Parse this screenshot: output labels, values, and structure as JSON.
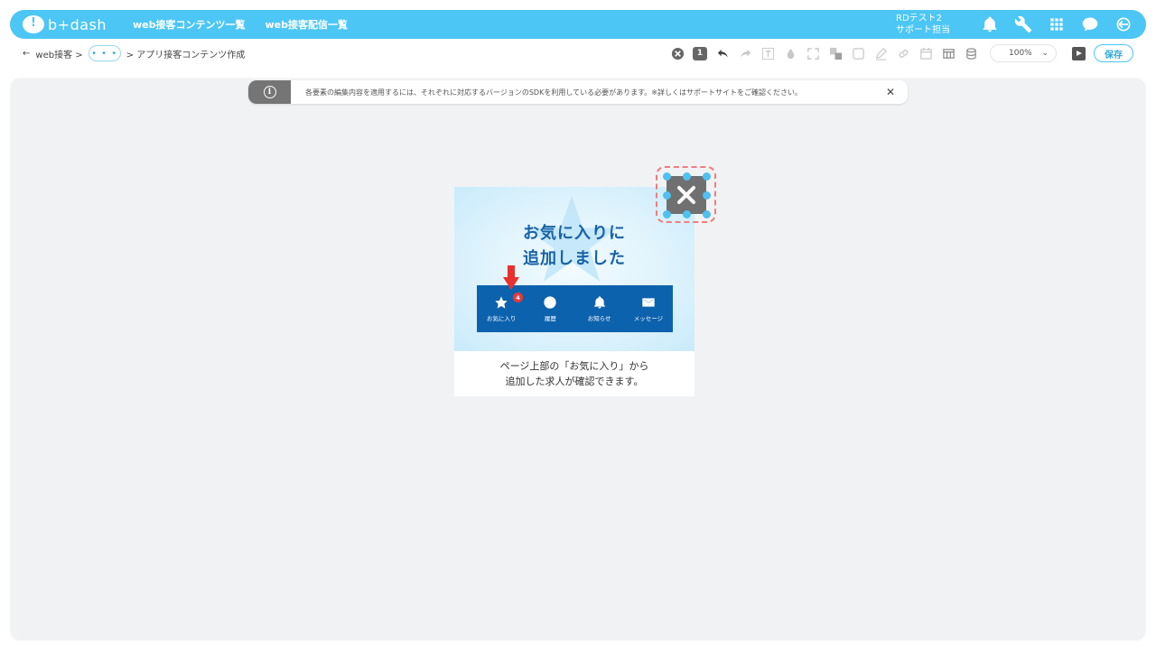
{
  "header": {
    "logo_text": "b+dash",
    "nav": [
      "web接客コンテンツ一覧",
      "web接客配信一覧"
    ],
    "user_line1": "RDテスト2",
    "user_line2": "サポート担当"
  },
  "breadcrumb": {
    "back_label": "web接客 >",
    "more_label": "• • •",
    "current": "> アプリ接客コンテンツ作成"
  },
  "toolbar": {
    "count": "1",
    "zoom": "100%",
    "save_label": "保存"
  },
  "notice": {
    "icon": "i",
    "text": "各要素の編集内容を適用するには、それぞれに対応するバージョンのSDKを利用している必要があります。※詳しくはサポートサイトをご確認ください。",
    "close": "✕"
  },
  "popup": {
    "title_line1": "お気に入りに",
    "title_line2": "追加しました",
    "tabs": [
      {
        "label": "お気に入り",
        "icon": "star-icon"
      },
      {
        "label": "履歴",
        "icon": "clock-icon"
      },
      {
        "label": "お知らせ",
        "icon": "bell-icon"
      },
      {
        "label": "メッセージ",
        "icon": "mail-icon"
      }
    ],
    "badge": "4",
    "caption_line1": "ページ上部の「お気に入り」から",
    "caption_line2": "追加した求人が確認できます。"
  },
  "colors": {
    "brand": "#4cc6f5",
    "tabbar": "#0d62ad",
    "title": "#1862a6",
    "selection_dash": "#ef7d7d",
    "handle": "#4fc0f0"
  }
}
